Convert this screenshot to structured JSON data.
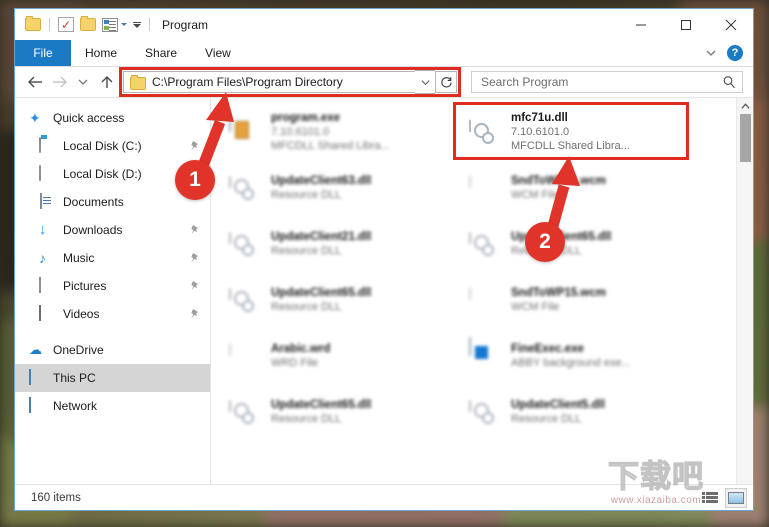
{
  "window": {
    "title": "Program",
    "quick_access": [
      "folder-icon",
      "properties-checkbox-icon",
      "folder-icon",
      "properties-icon",
      "customize-caret-icon"
    ],
    "controls": {
      "minimize": "minimize-icon",
      "maximize": "maximize-icon",
      "close": "close-icon"
    }
  },
  "ribbon": {
    "tabs": [
      {
        "label": "File",
        "active": true
      },
      {
        "label": "Home",
        "active": false
      },
      {
        "label": "Share",
        "active": false
      },
      {
        "label": "View",
        "active": false
      }
    ],
    "expand_icon": "chevron-down-icon",
    "help_label": "?"
  },
  "addressbar": {
    "back_icon": "arrow-left-icon",
    "forward_icon": "arrow-right-icon",
    "recent_icon": "chevron-down-icon",
    "up_icon": "arrow-up-icon",
    "path": "C:\\Program Files\\Program Directory",
    "dropdown_icon": "chevron-down-icon",
    "refresh_icon": "refresh-icon",
    "highlighted": true
  },
  "search": {
    "placeholder": "Search Program",
    "icon": "search-icon"
  },
  "sidebar": {
    "items": [
      {
        "label": "Quick access",
        "icon": "star-icon",
        "pinned": false,
        "selected": false,
        "indent": 0
      },
      {
        "label": "Local Disk (C:)",
        "icon": "disk-system-icon",
        "pinned": true,
        "selected": false,
        "indent": 1
      },
      {
        "label": "Local Disk (D:)",
        "icon": "disk-icon",
        "pinned": false,
        "selected": false,
        "indent": 1
      },
      {
        "label": "Documents",
        "icon": "documents-icon",
        "pinned": true,
        "selected": false,
        "indent": 1
      },
      {
        "label": "Downloads",
        "icon": "downloads-icon",
        "pinned": true,
        "selected": false,
        "indent": 1
      },
      {
        "label": "Music",
        "icon": "music-icon",
        "pinned": true,
        "selected": false,
        "indent": 1
      },
      {
        "label": "Pictures",
        "icon": "pictures-icon",
        "pinned": true,
        "selected": false,
        "indent": 1
      },
      {
        "label": "Videos",
        "icon": "videos-icon",
        "pinned": true,
        "selected": false,
        "indent": 1
      },
      {
        "label": "OneDrive",
        "icon": "onedrive-icon",
        "pinned": false,
        "selected": false,
        "indent": 0
      },
      {
        "label": "This PC",
        "icon": "this-pc-icon",
        "pinned": false,
        "selected": true,
        "indent": 0
      },
      {
        "label": "Network",
        "icon": "network-icon",
        "pinned": false,
        "selected": false,
        "indent": 0
      }
    ]
  },
  "files": [
    {
      "name": "program.exe",
      "version": "7.10.6101.0",
      "description": "MFCDLL Shared Libra...",
      "icon": "program-exe-icon",
      "blurred": true,
      "highlighted": false
    },
    {
      "name": "mfc71u.dll",
      "version": "7.10.6101.0",
      "description": "MFCDLL Shared Libra...",
      "icon": "dll-icon",
      "blurred": false,
      "highlighted": true
    },
    {
      "name": "UpdateClient63.dll",
      "version": "",
      "description": "Resource DLL",
      "icon": "dll-icon",
      "blurred": true,
      "highlighted": false
    },
    {
      "name": "SndToWP15.wcm",
      "version": "",
      "description": "WCM File",
      "icon": "blank-file-icon",
      "blurred": true,
      "highlighted": false
    },
    {
      "name": "UpdateClient21.dll",
      "version": "",
      "description": "Resource DLL",
      "icon": "dll-icon",
      "blurred": true,
      "highlighted": false
    },
    {
      "name": "UpdateClient65.dll",
      "version": "",
      "description": "Resource DLL",
      "icon": "dll-icon",
      "blurred": true,
      "highlighted": false
    },
    {
      "name": "UpdateClient65.dll",
      "version": "",
      "description": "Resource DLL",
      "icon": "dll-icon",
      "blurred": true,
      "highlighted": false
    },
    {
      "name": "SndToWP15.wcm",
      "version": "",
      "description": "WCM File",
      "icon": "blank-file-icon",
      "blurred": true,
      "highlighted": false
    },
    {
      "name": "Arabic.wrd",
      "version": "",
      "description": "WRD File",
      "icon": "blank-file-icon",
      "blurred": true,
      "highlighted": false
    },
    {
      "name": "FineExec.exe",
      "version": "",
      "description": "ABBY background exe...",
      "icon": "abby-exe-icon",
      "blurred": true,
      "highlighted": false
    },
    {
      "name": "UpdateClient65.dll",
      "version": "",
      "description": "Resource DLL",
      "icon": "dll-icon",
      "blurred": true,
      "highlighted": false
    },
    {
      "name": "UpdateClient5.dll",
      "version": "",
      "description": "Resource DLL",
      "icon": "dll-icon",
      "blurred": true,
      "highlighted": false
    }
  ],
  "statusbar": {
    "item_count": "160 items",
    "view_details_icon": "details-view-icon",
    "view_thumbnails_icon": "thumbnails-view-icon"
  },
  "annotations": [
    {
      "number": "1",
      "target": "address-bar"
    },
    {
      "number": "2",
      "target": "mfc71u-dll-file"
    }
  ],
  "watermark": {
    "primary": "下载吧",
    "secondary": "www.xiazaiba.com"
  },
  "colors": {
    "accent": "#1a7bc4",
    "annotation_red": "#e0342a",
    "selected_row": "#d5d5d5"
  }
}
